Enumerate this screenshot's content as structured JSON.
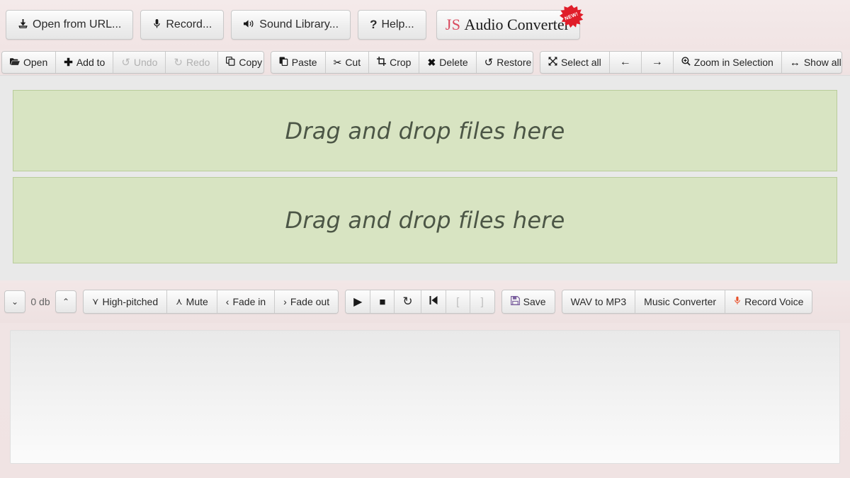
{
  "app": {
    "logo_js": "JS",
    "logo_rest": "Audio Converter",
    "logo_badge": "NEW!",
    "brand_color": "#d94a5e",
    "page_bg": "#f0e3e3",
    "dropzone_bg": "#d8e4c2",
    "dropzone_border": "#b9cc9b"
  },
  "topbar": {
    "buttons": [
      {
        "label": "Open from URL...",
        "icon": "download-icon",
        "glyph": "⭳",
        "name": "open-from-url-button"
      },
      {
        "label": "Record...",
        "icon": "microphone-icon",
        "glyph": "🎤",
        "name": "record-button"
      },
      {
        "label": "Sound Library...",
        "icon": "speaker-icon",
        "glyph": "🔊",
        "name": "sound-library-button"
      },
      {
        "label": "Help...",
        "icon": "question-mark-icon",
        "glyph": "?",
        "name": "help-button"
      }
    ]
  },
  "toolbar": {
    "groups": [
      {
        "name": "file-group",
        "buttons": [
          {
            "label": "Open",
            "icon": "folder-open-icon",
            "glyph": "📂",
            "name": "open-button",
            "disabled": false
          },
          {
            "label": "Add to",
            "icon": "plus-icon",
            "glyph": "✚",
            "name": "add-to-button",
            "disabled": false
          },
          {
            "label": "Undo",
            "icon": "undo-arrow-icon",
            "glyph": "↶",
            "name": "undo-button",
            "disabled": true
          },
          {
            "label": "Redo",
            "icon": "redo-arrow-icon",
            "glyph": "↷",
            "name": "redo-button",
            "disabled": true
          },
          {
            "label": "Copy",
            "icon": "copy-icon",
            "glyph": "❐",
            "name": "copy-button",
            "disabled": false
          }
        ]
      },
      {
        "name": "edit-group",
        "buttons": [
          {
            "label": "Paste",
            "icon": "paste-icon",
            "glyph": "📋",
            "name": "paste-button",
            "disabled": false
          },
          {
            "label": "Cut",
            "icon": "scissors-icon",
            "glyph": "✂",
            "name": "cut-button",
            "disabled": false
          },
          {
            "label": "Crop",
            "icon": "crop-icon",
            "glyph": "⛶",
            "name": "crop-button",
            "disabled": false
          },
          {
            "label": "Delete",
            "icon": "cross-icon",
            "glyph": "✖",
            "name": "delete-button",
            "disabled": false
          },
          {
            "label": "Restore",
            "icon": "restore-arrow-icon",
            "glyph": "↺",
            "name": "restore-button",
            "disabled": false
          }
        ]
      },
      {
        "name": "selection-group",
        "buttons": [
          {
            "label": "Select all",
            "icon": "expand-arrows-icon",
            "glyph": "⤢",
            "name": "select-all-button",
            "disabled": false
          },
          {
            "label": "←",
            "icon": "arrow-left-icon",
            "glyph": "",
            "name": "move-left-button",
            "disabled": false,
            "arrow": true
          },
          {
            "label": "→",
            "icon": "arrow-right-icon",
            "glyph": "",
            "name": "move-right-button",
            "disabled": false,
            "arrow": true
          },
          {
            "label": "Zoom in Selection",
            "icon": "magnifier-plus-icon",
            "glyph": "🔍",
            "name": "zoom-in-selection-button",
            "disabled": false
          },
          {
            "label": "Show all",
            "icon": "left-right-arrow-icon",
            "glyph": "↔",
            "name": "show-all-button",
            "disabled": false
          }
        ]
      }
    ]
  },
  "editor": {
    "track_1_placeholder": "Drag and drop files here",
    "track_2_placeholder": "Drag and drop files here"
  },
  "bottombar": {
    "gain": {
      "value": "0 db",
      "decrease_glyph": "⌄",
      "increase_glyph": "⌃"
    },
    "effects": [
      {
        "label": "High-pitched",
        "icon": "chevron-double-up-icon",
        "glyph": "«",
        "name": "high-pitched-button"
      },
      {
        "label": "Mute",
        "icon": "chevron-double-down-icon",
        "glyph": "»",
        "name": "mute-button"
      },
      {
        "label": "Fade in",
        "icon": "chevron-left-icon",
        "glyph": "‹",
        "name": "fade-in-button"
      },
      {
        "label": "Fade out",
        "icon": "chevron-right-icon",
        "glyph": "›",
        "name": "fade-out-button"
      }
    ],
    "transport": [
      {
        "label": "▶",
        "icon": "play-icon",
        "name": "play-button",
        "disabled": false,
        "style": "play"
      },
      {
        "label": "■",
        "icon": "stop-icon",
        "name": "stop-button",
        "disabled": false,
        "style": "stop"
      },
      {
        "label": "↻",
        "icon": "loop-icon",
        "name": "loop-button",
        "disabled": false,
        "style": ""
      },
      {
        "label": "⧏▌",
        "icon": "skip-to-start-icon",
        "name": "skip-to-start-button",
        "disabled": false,
        "style": "skip"
      },
      {
        "label": "[",
        "icon": "bracket-left-icon",
        "name": "mark-start-button",
        "disabled": true,
        "style": ""
      },
      {
        "label": "]",
        "icon": "bracket-right-icon",
        "name": "mark-end-button",
        "disabled": true,
        "style": ""
      }
    ],
    "save": {
      "label": "Save",
      "icon": "floppy-disk-icon",
      "glyph": "💾",
      "name": "save-button"
    },
    "links": [
      {
        "label": "WAV to MP3",
        "icon": "",
        "glyph": "",
        "name": "wav-to-mp3-button"
      },
      {
        "label": "Music Converter",
        "icon": "",
        "glyph": "",
        "name": "music-converter-button"
      },
      {
        "label": "Record Voice",
        "icon": "microphone-red-icon",
        "glyph": "🎤",
        "name": "record-voice-button"
      }
    ]
  }
}
